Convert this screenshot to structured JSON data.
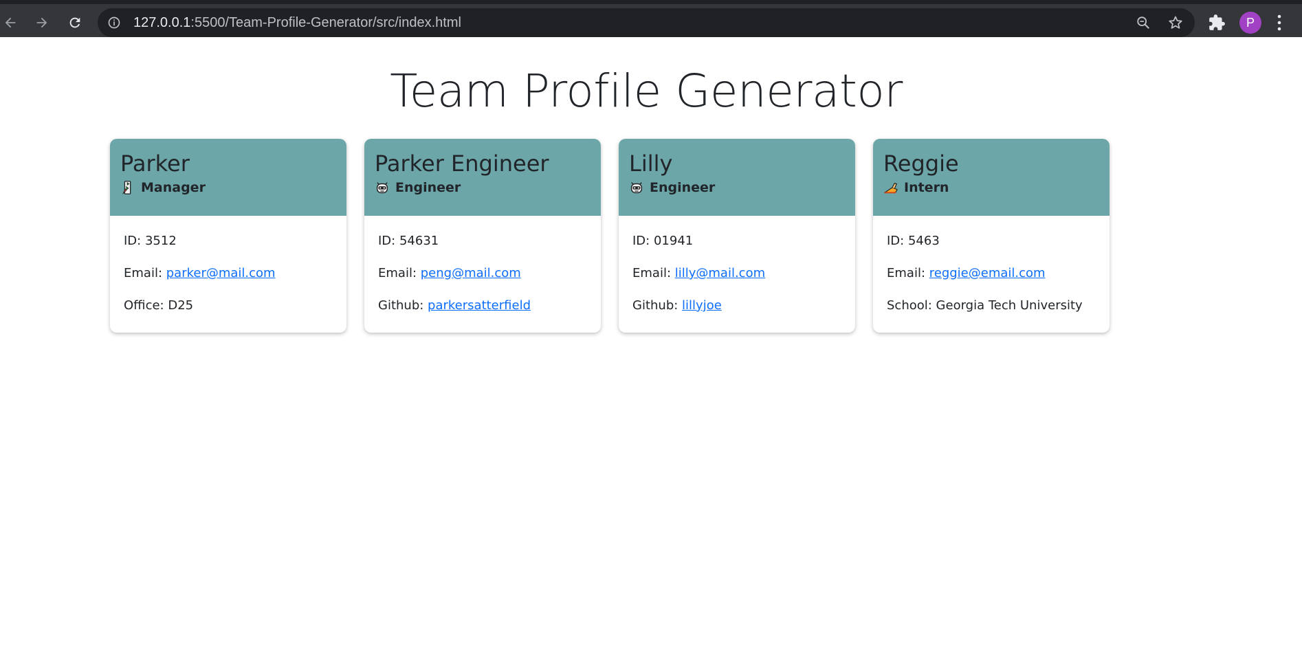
{
  "browser": {
    "url_host": "127.0.0.1",
    "url_rest": ":5500/Team-Profile-Generator/src/index.html",
    "avatar_letter": "P",
    "icons": [
      "back-arrow-icon",
      "forward-arrow-icon",
      "reload-icon",
      "info-icon",
      "zoom-icon",
      "star-icon",
      "puzzle-icon",
      "kebab-menu-icon"
    ]
  },
  "page": {
    "title": "Team Profile Generator"
  },
  "colors": {
    "card_header": "#6ca6a8",
    "link": "#0d6efd",
    "avatar": "#a142c4"
  },
  "cards": [
    {
      "name": "Parker",
      "role": "Manager",
      "role_icon": "manager-icon",
      "id_label": "ID: ",
      "id": "3512",
      "email_label": "Email: ",
      "email": "parker@mail.com",
      "extra_label": "Office: ",
      "extra": "D25"
    },
    {
      "name": "Parker Engineer",
      "role": "Engineer",
      "role_icon": "engineer-icon",
      "id_label": "ID: ",
      "id": "54631",
      "email_label": "Email: ",
      "email": "peng@mail.com",
      "extra_label": "Github: ",
      "extra": "parkersatterfield"
    },
    {
      "name": "Lilly",
      "role": "Engineer",
      "role_icon": "engineer-icon",
      "id_label": "ID: ",
      "id": "01941",
      "email_label": "Email: ",
      "email": "lilly@mail.com",
      "extra_label": "Github: ",
      "extra": "lillyjoe"
    },
    {
      "name": "Reggie",
      "role": "Intern",
      "role_icon": "intern-icon",
      "id_label": "ID: ",
      "id": "5463",
      "email_label": "Email: ",
      "email": "reggie@email.com",
      "extra_label": "School: ",
      "extra": "Georgia Tech University"
    }
  ]
}
